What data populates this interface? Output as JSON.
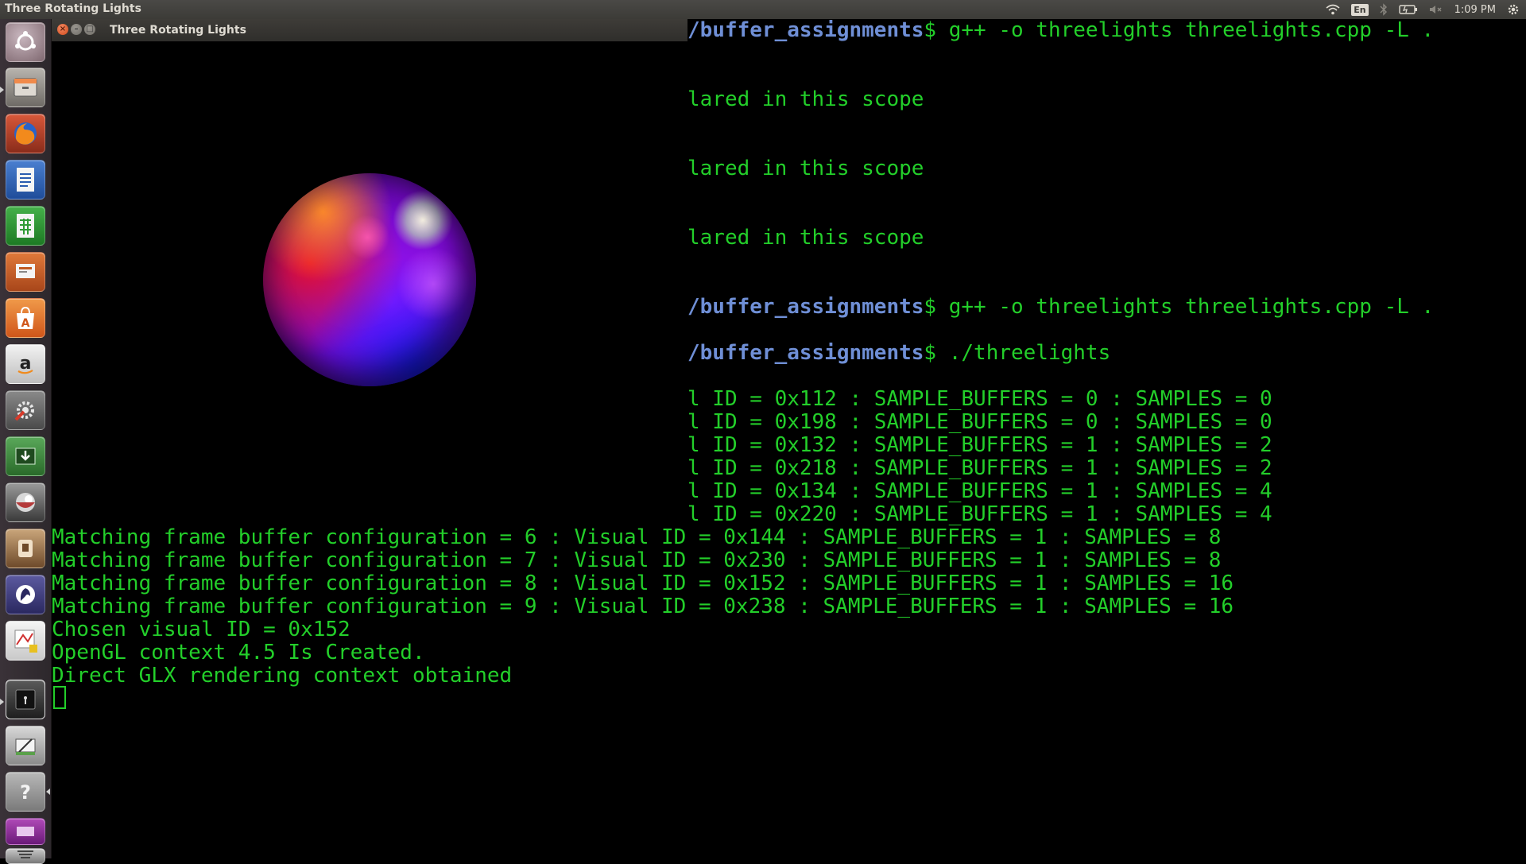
{
  "top_panel": {
    "app_title": "Three Rotating Lights",
    "keyboard_layout": "En",
    "clock": "1:09 PM"
  },
  "launcher": {
    "icons": [
      "ubuntu-dash-icon",
      "files-icon",
      "firefox-icon",
      "writer-icon",
      "calc-icon",
      "impress-icon",
      "software-center-icon",
      "amazon-icon",
      "system-settings-icon",
      "update-manager-icon",
      "blender-icon",
      "app-icon",
      "inkscape-icon",
      "app-icon",
      "terminal-icon",
      "app-icon",
      "help-icon",
      "app-icon",
      "trash-icon"
    ]
  },
  "gl_window": {
    "title": "Three Rotating Lights"
  },
  "terminal": {
    "path_prompt": "/buffer_assignments",
    "prompt_symbol": "$",
    "compile_command": " g++ -o threelights threelights.cpp -L .",
    "run_command": " ./threelights",
    "error_text": "lared in this scope",
    "frag_visual_lines": [
      "l ID = 0x112 : SAMPLE_BUFFERS = 0 : SAMPLES = 0",
      "l ID = 0x198 : SAMPLE_BUFFERS = 0 : SAMPLES = 0",
      "l ID = 0x132 : SAMPLE_BUFFERS = 1 : SAMPLES = 2",
      "l ID = 0x218 : SAMPLE_BUFFERS = 1 : SAMPLES = 2",
      "l ID = 0x134 : SAMPLE_BUFFERS = 1 : SAMPLES = 4",
      "l ID = 0x220 : SAMPLE_BUFFERS = 1 : SAMPLES = 4"
    ],
    "full_lines": [
      "Matching frame buffer configuration = 6 : Visual ID = 0x144 : SAMPLE_BUFFERS = 1 : SAMPLES = 8",
      "Matching frame buffer configuration = 7 : Visual ID = 0x230 : SAMPLE_BUFFERS = 1 : SAMPLES = 8",
      "Matching frame buffer configuration = 8 : Visual ID = 0x152 : SAMPLE_BUFFERS = 1 : SAMPLES = 16",
      "Matching frame buffer configuration = 9 : Visual ID = 0x238 : SAMPLE_BUFFERS = 1 : SAMPLES = 16",
      "Chosen visual ID = 0x152",
      "OpenGL context 4.5 Is Created.",
      "Direct GLX rendering context obtained"
    ]
  },
  "colors": {
    "terminal_text": "#23cf2a",
    "prompt_path": "#6f8fd6",
    "panel": "#3c3b37"
  }
}
